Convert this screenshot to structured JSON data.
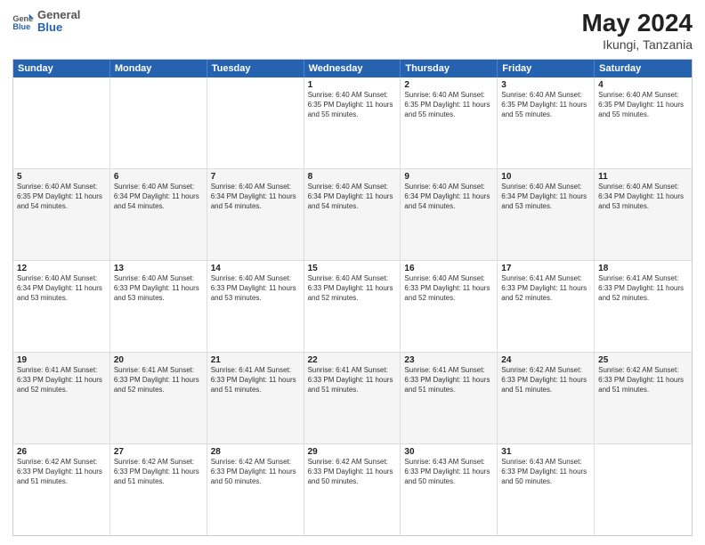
{
  "header": {
    "logo": {
      "line1": "General",
      "line2": "Blue"
    },
    "title": "May 2024",
    "location": "Ikungi, Tanzania"
  },
  "days_of_week": [
    "Sunday",
    "Monday",
    "Tuesday",
    "Wednesday",
    "Thursday",
    "Friday",
    "Saturday"
  ],
  "rows": [
    {
      "alt": false,
      "cells": [
        {
          "day": "",
          "text": ""
        },
        {
          "day": "",
          "text": ""
        },
        {
          "day": "",
          "text": ""
        },
        {
          "day": "1",
          "text": "Sunrise: 6:40 AM\nSunset: 6:35 PM\nDaylight: 11 hours\nand 55 minutes."
        },
        {
          "day": "2",
          "text": "Sunrise: 6:40 AM\nSunset: 6:35 PM\nDaylight: 11 hours\nand 55 minutes."
        },
        {
          "day": "3",
          "text": "Sunrise: 6:40 AM\nSunset: 6:35 PM\nDaylight: 11 hours\nand 55 minutes."
        },
        {
          "day": "4",
          "text": "Sunrise: 6:40 AM\nSunset: 6:35 PM\nDaylight: 11 hours\nand 55 minutes."
        }
      ]
    },
    {
      "alt": true,
      "cells": [
        {
          "day": "5",
          "text": "Sunrise: 6:40 AM\nSunset: 6:35 PM\nDaylight: 11 hours\nand 54 minutes."
        },
        {
          "day": "6",
          "text": "Sunrise: 6:40 AM\nSunset: 6:34 PM\nDaylight: 11 hours\nand 54 minutes."
        },
        {
          "day": "7",
          "text": "Sunrise: 6:40 AM\nSunset: 6:34 PM\nDaylight: 11 hours\nand 54 minutes."
        },
        {
          "day": "8",
          "text": "Sunrise: 6:40 AM\nSunset: 6:34 PM\nDaylight: 11 hours\nand 54 minutes."
        },
        {
          "day": "9",
          "text": "Sunrise: 6:40 AM\nSunset: 6:34 PM\nDaylight: 11 hours\nand 54 minutes."
        },
        {
          "day": "10",
          "text": "Sunrise: 6:40 AM\nSunset: 6:34 PM\nDaylight: 11 hours\nand 53 minutes."
        },
        {
          "day": "11",
          "text": "Sunrise: 6:40 AM\nSunset: 6:34 PM\nDaylight: 11 hours\nand 53 minutes."
        }
      ]
    },
    {
      "alt": false,
      "cells": [
        {
          "day": "12",
          "text": "Sunrise: 6:40 AM\nSunset: 6:34 PM\nDaylight: 11 hours\nand 53 minutes."
        },
        {
          "day": "13",
          "text": "Sunrise: 6:40 AM\nSunset: 6:33 PM\nDaylight: 11 hours\nand 53 minutes."
        },
        {
          "day": "14",
          "text": "Sunrise: 6:40 AM\nSunset: 6:33 PM\nDaylight: 11 hours\nand 53 minutes."
        },
        {
          "day": "15",
          "text": "Sunrise: 6:40 AM\nSunset: 6:33 PM\nDaylight: 11 hours\nand 52 minutes."
        },
        {
          "day": "16",
          "text": "Sunrise: 6:40 AM\nSunset: 6:33 PM\nDaylight: 11 hours\nand 52 minutes."
        },
        {
          "day": "17",
          "text": "Sunrise: 6:41 AM\nSunset: 6:33 PM\nDaylight: 11 hours\nand 52 minutes."
        },
        {
          "day": "18",
          "text": "Sunrise: 6:41 AM\nSunset: 6:33 PM\nDaylight: 11 hours\nand 52 minutes."
        }
      ]
    },
    {
      "alt": true,
      "cells": [
        {
          "day": "19",
          "text": "Sunrise: 6:41 AM\nSunset: 6:33 PM\nDaylight: 11 hours\nand 52 minutes."
        },
        {
          "day": "20",
          "text": "Sunrise: 6:41 AM\nSunset: 6:33 PM\nDaylight: 11 hours\nand 52 minutes."
        },
        {
          "day": "21",
          "text": "Sunrise: 6:41 AM\nSunset: 6:33 PM\nDaylight: 11 hours\nand 51 minutes."
        },
        {
          "day": "22",
          "text": "Sunrise: 6:41 AM\nSunset: 6:33 PM\nDaylight: 11 hours\nand 51 minutes."
        },
        {
          "day": "23",
          "text": "Sunrise: 6:41 AM\nSunset: 6:33 PM\nDaylight: 11 hours\nand 51 minutes."
        },
        {
          "day": "24",
          "text": "Sunrise: 6:42 AM\nSunset: 6:33 PM\nDaylight: 11 hours\nand 51 minutes."
        },
        {
          "day": "25",
          "text": "Sunrise: 6:42 AM\nSunset: 6:33 PM\nDaylight: 11 hours\nand 51 minutes."
        }
      ]
    },
    {
      "alt": false,
      "cells": [
        {
          "day": "26",
          "text": "Sunrise: 6:42 AM\nSunset: 6:33 PM\nDaylight: 11 hours\nand 51 minutes."
        },
        {
          "day": "27",
          "text": "Sunrise: 6:42 AM\nSunset: 6:33 PM\nDaylight: 11 hours\nand 51 minutes."
        },
        {
          "day": "28",
          "text": "Sunrise: 6:42 AM\nSunset: 6:33 PM\nDaylight: 11 hours\nand 50 minutes."
        },
        {
          "day": "29",
          "text": "Sunrise: 6:42 AM\nSunset: 6:33 PM\nDaylight: 11 hours\nand 50 minutes."
        },
        {
          "day": "30",
          "text": "Sunrise: 6:43 AM\nSunset: 6:33 PM\nDaylight: 11 hours\nand 50 minutes."
        },
        {
          "day": "31",
          "text": "Sunrise: 6:43 AM\nSunset: 6:33 PM\nDaylight: 11 hours\nand 50 minutes."
        },
        {
          "day": "",
          "text": ""
        }
      ]
    }
  ]
}
